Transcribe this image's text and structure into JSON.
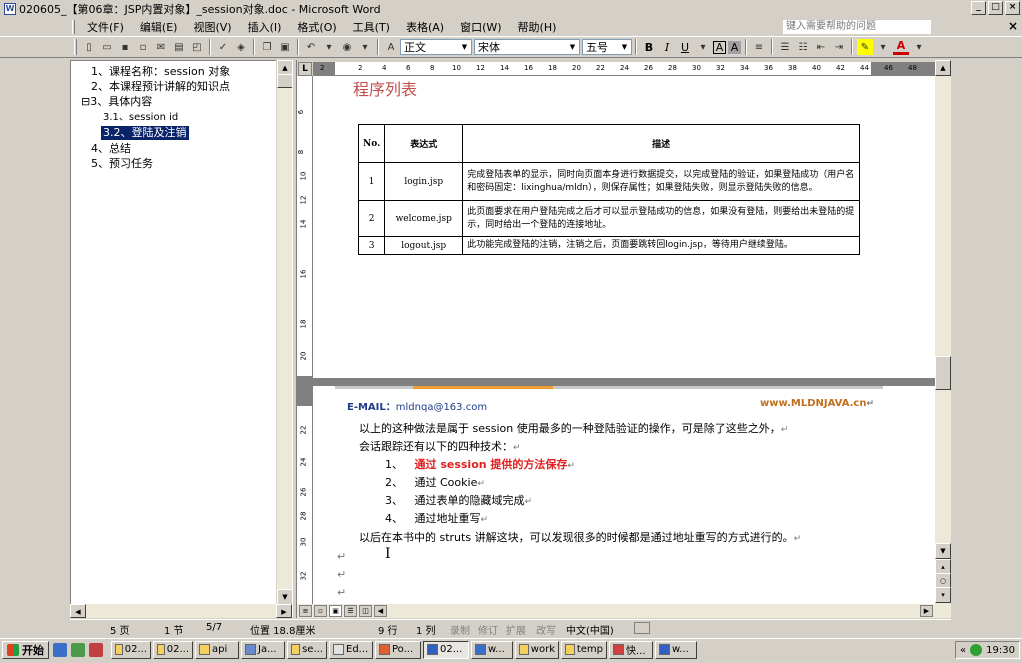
{
  "window": {
    "title": "020605_【第06章：JSP内置对象】_session对象.doc - Microsoft Word",
    "controls": [
      "_",
      "□",
      "×"
    ]
  },
  "menu": {
    "items": [
      "文件(F)",
      "编辑(E)",
      "视图(V)",
      "插入(I)",
      "格式(O)",
      "工具(T)",
      "表格(A)",
      "窗口(W)",
      "帮助(H)"
    ],
    "help_placeholder": "键入需要帮助的问题",
    "close": "×"
  },
  "toolbar": {
    "style": "正文",
    "font": "宋体",
    "size": "五号",
    "bold": "B",
    "italic": "I",
    "underline": "U",
    "char_border": "A",
    "char_shade": "A"
  },
  "doc_map": {
    "items": [
      {
        "label": "1、课程名称：session 对象",
        "expander": ""
      },
      {
        "label": "2、本课程预计讲解的知识点",
        "expander": ""
      },
      {
        "label": "3、具体内容",
        "expander": "⊟"
      },
      {
        "label": "3.1、session id",
        "expander": ""
      },
      {
        "label": "3.2、登陆及注销",
        "expander": "",
        "selected": true
      },
      {
        "label": "4、总结",
        "expander": ""
      },
      {
        "label": "5、预习任务",
        "expander": ""
      }
    ]
  },
  "ruler": {
    "h_ticks": [
      "2",
      "2",
      "4",
      "6",
      "8",
      "10",
      "12",
      "14",
      "16",
      "18",
      "20",
      "22",
      "24",
      "26",
      "28",
      "30",
      "32",
      "34",
      "36",
      "38",
      "40",
      "42",
      "44",
      "46",
      "48"
    ],
    "v_ticks": [
      "6",
      "8",
      "10",
      "12",
      "14",
      "16",
      "18",
      "20",
      "22",
      "24",
      "26",
      "28",
      "30",
      "32"
    ]
  },
  "document": {
    "section_title": "程序列表",
    "table": {
      "headers": [
        "No.",
        "表达式",
        "描述"
      ],
      "rows": [
        {
          "no": "1",
          "expr": "login.jsp",
          "desc": "完成登陆表单的显示，同时向页面本身进行数据提交，以完成登陆的验证，如果登陆成功（用户名和密码固定：lixinghua/mldn），则保存属性；如果登陆失败，则显示登陆失败的信息。"
        },
        {
          "no": "2",
          "expr": "welcome.jsp",
          "desc": "此页面要求在用户登陆完成之后才可以显示登陆成功的信息，如果没有登陆，则要给出未登陆的提示，同时给出一个登陆的连接地址。"
        },
        {
          "no": "3",
          "expr": "logout.jsp",
          "desc": "此功能完成登陆的注销，注销之后，页面要跳转回login.jsp，等待用户继续登陆。"
        }
      ]
    },
    "header": {
      "email_label": "E-MAIL：",
      "email": "mldnqa@163.com",
      "site": "www.MLDNJAVA.cn"
    },
    "paragraphs": [
      "以上的这种做法是属于 session 使用最多的一种登陆验证的操作，可是除了这些之外，",
      "会话跟踪还有以下的四种技术：",
      "1、",
      "通过 session 提供的方法保存",
      "2、",
      "通过 Cookie",
      "3、",
      "通过表单的隐藏域完成",
      "4、",
      "通过地址重写",
      "以后在本书中的 struts 讲解这块，可以发现很多的时候都是通过地址重写的方式进行的。"
    ],
    "para_mark": "↵"
  },
  "status": {
    "page": "5 页",
    "section": "1 节",
    "pages": "5/7",
    "position": "位置 18.8厘米",
    "line": "9 行",
    "column": "1 列",
    "rec": "录制",
    "trk": "修订",
    "ext": "扩展",
    "ovr": "改写",
    "lang": "中文(中国)"
  },
  "taskbar": {
    "start": "开始",
    "tasks": [
      "02...",
      "02...",
      "api",
      "Ja...",
      "se...",
      "Ed...",
      "Po...",
      "02...",
      "w...",
      "work",
      "temp",
      "快...",
      "w..."
    ],
    "active_task_index": 7,
    "clock": "19:30"
  }
}
